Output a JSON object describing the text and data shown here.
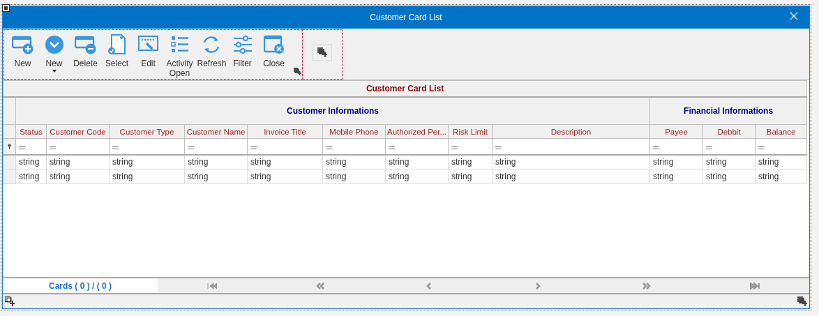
{
  "window": {
    "title": "Customer Card List"
  },
  "toolbar": {
    "buttons": [
      {
        "label": "New",
        "kind": "window-plus",
        "has_menu": false
      },
      {
        "label": "New",
        "kind": "chevron-down",
        "has_menu": true
      },
      {
        "label": "Delete",
        "kind": "window-minus",
        "has_menu": false
      },
      {
        "label": "Select",
        "kind": "document-check",
        "has_menu": false
      },
      {
        "label": "Edit",
        "kind": "edit",
        "has_menu": false
      },
      {
        "label": "Activity Open",
        "kind": "list",
        "has_menu": false
      },
      {
        "label": "Refresh",
        "kind": "refresh",
        "has_menu": false
      },
      {
        "label": "Filter",
        "kind": "sliders",
        "has_menu": false
      },
      {
        "label": "Close",
        "kind": "window-close",
        "has_menu": false
      }
    ]
  },
  "grid": {
    "title": "Customer Card List",
    "bands": [
      {
        "label": "Customer Informations",
        "columns": [
          "Status",
          "Customer Code",
          "Customer Type",
          "Customer Name",
          "Invoice Title",
          "Mobile Phone",
          "Authorized Per...",
          "Risk Limit",
          "Description"
        ]
      },
      {
        "label": "Financial Informations",
        "columns": [
          "Payee",
          "Debbit",
          "Balance"
        ]
      }
    ],
    "rows": [
      [
        "string",
        "string",
        "string",
        "string",
        "string",
        "string",
        "string",
        "string",
        "string",
        "string",
        "string",
        "string"
      ],
      [
        "string",
        "string",
        "string",
        "string",
        "string",
        "string",
        "string",
        "string",
        "string",
        "string",
        "string",
        "string"
      ]
    ]
  },
  "pager": {
    "summary": "Cards ( 0 ) / ( 0 )"
  }
}
